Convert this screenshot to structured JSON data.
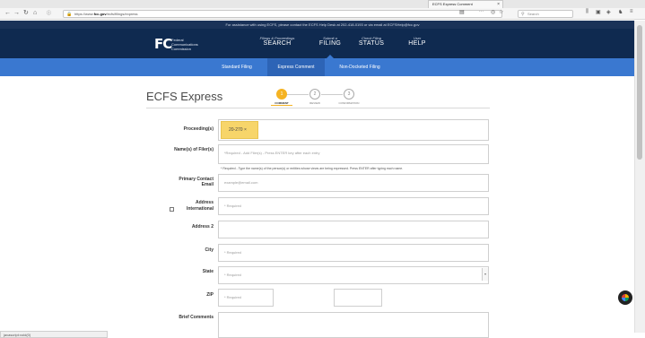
{
  "browser": {
    "tab_title": "ECFS Express Comment",
    "tab_close": "×",
    "url_prefix": "https://www.",
    "url_domain": "fcc.gov",
    "url_path": "/ecfs/filings/express",
    "search_placeholder": "Search",
    "status_url": "javascript:void(0)"
  },
  "notice": "For assistance with using ECFS, please contact the ECFS Help Desk at 202-418-0193 or via email at ECFSHelp@fcc.gov",
  "header": {
    "logo_mark": "FC",
    "agency_line1": "Federal",
    "agency_line2": "Communications",
    "agency_line3": "Commission",
    "nav": [
      {
        "small": "Filings & Proceedings",
        "big": "SEARCH"
      },
      {
        "small": "Submit a",
        "big": "FILING"
      },
      {
        "small": "Check Filing",
        "big": "STATUS"
      },
      {
        "small": "User",
        "big": "HELP"
      }
    ]
  },
  "subnav": {
    "items": [
      "Standard Filing",
      "Express Comment",
      "Non-Docketed Filing"
    ]
  },
  "page": {
    "title": "ECFS Express",
    "steps": [
      {
        "num": "1",
        "label": "COMMENT"
      },
      {
        "num": "2",
        "label": "REVIEW"
      },
      {
        "num": "3",
        "label": "CONFIRMATION"
      }
    ]
  },
  "form": {
    "proceeding_label": "Proceeding(s)",
    "proceeding_chip": "20-270 ×",
    "filers_label": "Name(s) of Filer(s)",
    "filers_placeholder": "*Required - Add Filer(s) - Press ENTER key after each entry",
    "filers_hint": "* Required - Type the name(s) of the person(s) or entities whose views are being expressed. Press ENTER after typing each name.",
    "email_label_1": "Primary Contact",
    "email_label_2": "Email",
    "email_placeholder": "example@email.com",
    "address_label": "Address",
    "international_label": "International",
    "address_placeholder": "* Required",
    "address2_label": "Address 2",
    "city_label": "City",
    "city_placeholder": "* Required",
    "state_label": "State",
    "state_placeholder": "* Required",
    "zip_label": "ZIP",
    "zip_placeholder": "* Required",
    "comments_label": "Brief Comments"
  }
}
